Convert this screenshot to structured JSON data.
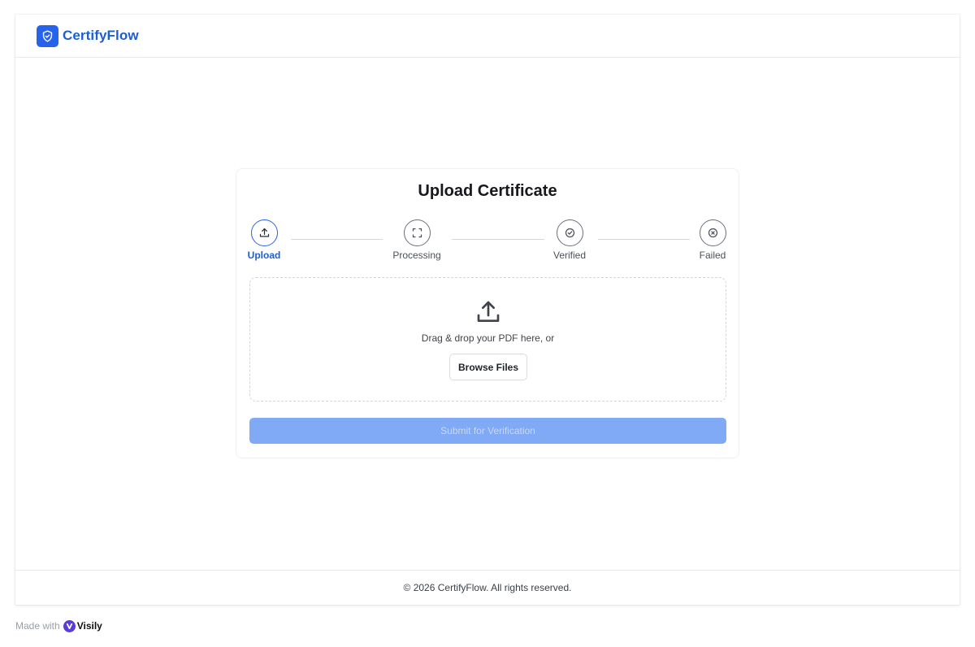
{
  "app": {
    "brand": "CertifyFlow",
    "brand_color": "#1d5fd1",
    "logo_icon": "shield-check-icon"
  },
  "card": {
    "title": "Upload Certificate"
  },
  "steps": [
    {
      "label": "Upload",
      "icon": "upload-icon",
      "active": true
    },
    {
      "label": "Processing",
      "icon": "scan-icon",
      "active": false
    },
    {
      "label": "Verified",
      "icon": "check-circle-icon",
      "active": false
    },
    {
      "label": "Failed",
      "icon": "x-circle-icon",
      "active": false
    }
  ],
  "dropzone": {
    "icon": "upload-tray-icon",
    "text": "Drag & drop your PDF here, or",
    "browse_label": "Browse Files"
  },
  "submit": {
    "label": "Submit for Verification",
    "disabled": true,
    "color": "#80aaf5"
  },
  "footer": {
    "text": "© 2026 CertifyFlow. All rights reserved."
  },
  "watermark": {
    "prefix": "Made with",
    "brand": "Visily"
  },
  "colors": {
    "accent": "#2563eb",
    "inactive_step": "#6b7078"
  }
}
